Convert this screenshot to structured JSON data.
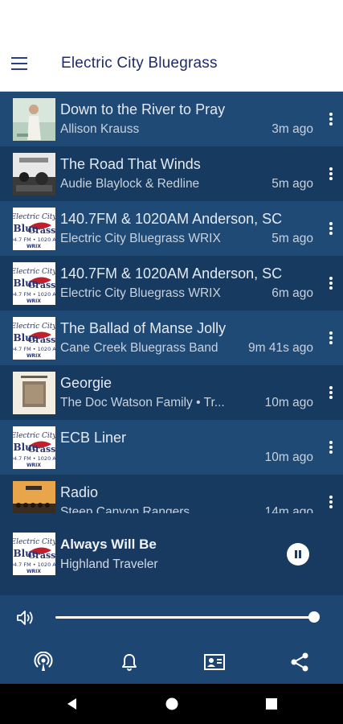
{
  "app": {
    "title": "Electric City Bluegrass"
  },
  "tracks": [
    {
      "title": "Down to the River to Pray",
      "artist": "Allison Krauss",
      "time": "3m ago",
      "thumb": "photo-woman"
    },
    {
      "title": "The Road That Winds",
      "artist": "Audie Blaylock & Redline",
      "time": "5m ago",
      "thumb": "photo-bw"
    },
    {
      "title": "140.7FM & 1020AM Anderson, SC",
      "artist": "Electric City Bluegrass WRIX",
      "time": "5m ago",
      "thumb": "station-logo"
    },
    {
      "title": "140.7FM & 1020AM Anderson, SC",
      "artist": "Electric City Bluegrass WRIX",
      "time": "6m ago",
      "thumb": "station-logo"
    },
    {
      "title": "The Ballad of Manse Jolly",
      "artist": "Cane Creek Bluegrass Band",
      "time": "9m 41s ago",
      "thumb": "station-logo"
    },
    {
      "title": "Georgie",
      "artist": "The Doc Watson Family • Tr...",
      "time": "10m ago",
      "thumb": "photo-album"
    },
    {
      "title": "ECB Liner",
      "artist": "",
      "time": "10m ago",
      "thumb": "station-logo"
    },
    {
      "title": "Radio",
      "artist": "Steep Canyon Rangers",
      "time": "14m ago",
      "thumb": "photo-band"
    }
  ],
  "now_playing": {
    "title": "Always Will Be",
    "artist": "Highland Traveler",
    "thumb": "station-logo"
  },
  "volume": {
    "level": 1.0
  },
  "colors": {
    "header_text": "#1f2a6b",
    "list_bg_a": "#1f4a76",
    "list_bg_b": "#173a61",
    "player_bg": "#183a60",
    "nav_bg": "#1e4672"
  },
  "icons": {
    "menu": "hamburger-icon",
    "more": "more-vert-icon",
    "pause": "pause-icon",
    "volume": "volume-icon",
    "nav": [
      "podcast-icon",
      "bell-icon",
      "contact-card-icon",
      "share-icon"
    ],
    "system": [
      "back-icon",
      "home-icon",
      "recents-icon"
    ]
  }
}
